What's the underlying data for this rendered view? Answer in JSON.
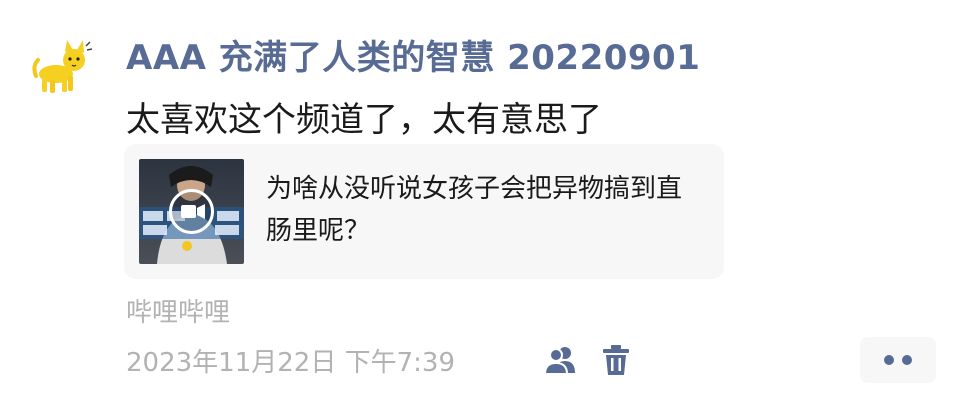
{
  "post": {
    "author": "AAA 充满了人类的智慧 20220901",
    "text": "太喜欢这个频道了，太有意思了"
  },
  "link_card": {
    "title": "为啥从没听说女孩子会把异物搞到直肠里呢？"
  },
  "source_label": "哔哩哔哩",
  "timestamp": "2023年11月22日 下午7:39",
  "icons": {
    "avatar": "yellow-cat-avatar",
    "play": "video-play-icon",
    "visibility": "people-icon",
    "delete": "trash-icon",
    "more": "more-dots-icon"
  },
  "colors": {
    "link_blue": "#576b95",
    "text_dark": "#1a1a1a",
    "meta_gray": "#b2b2b2",
    "card_bg": "#f7f7f7"
  }
}
